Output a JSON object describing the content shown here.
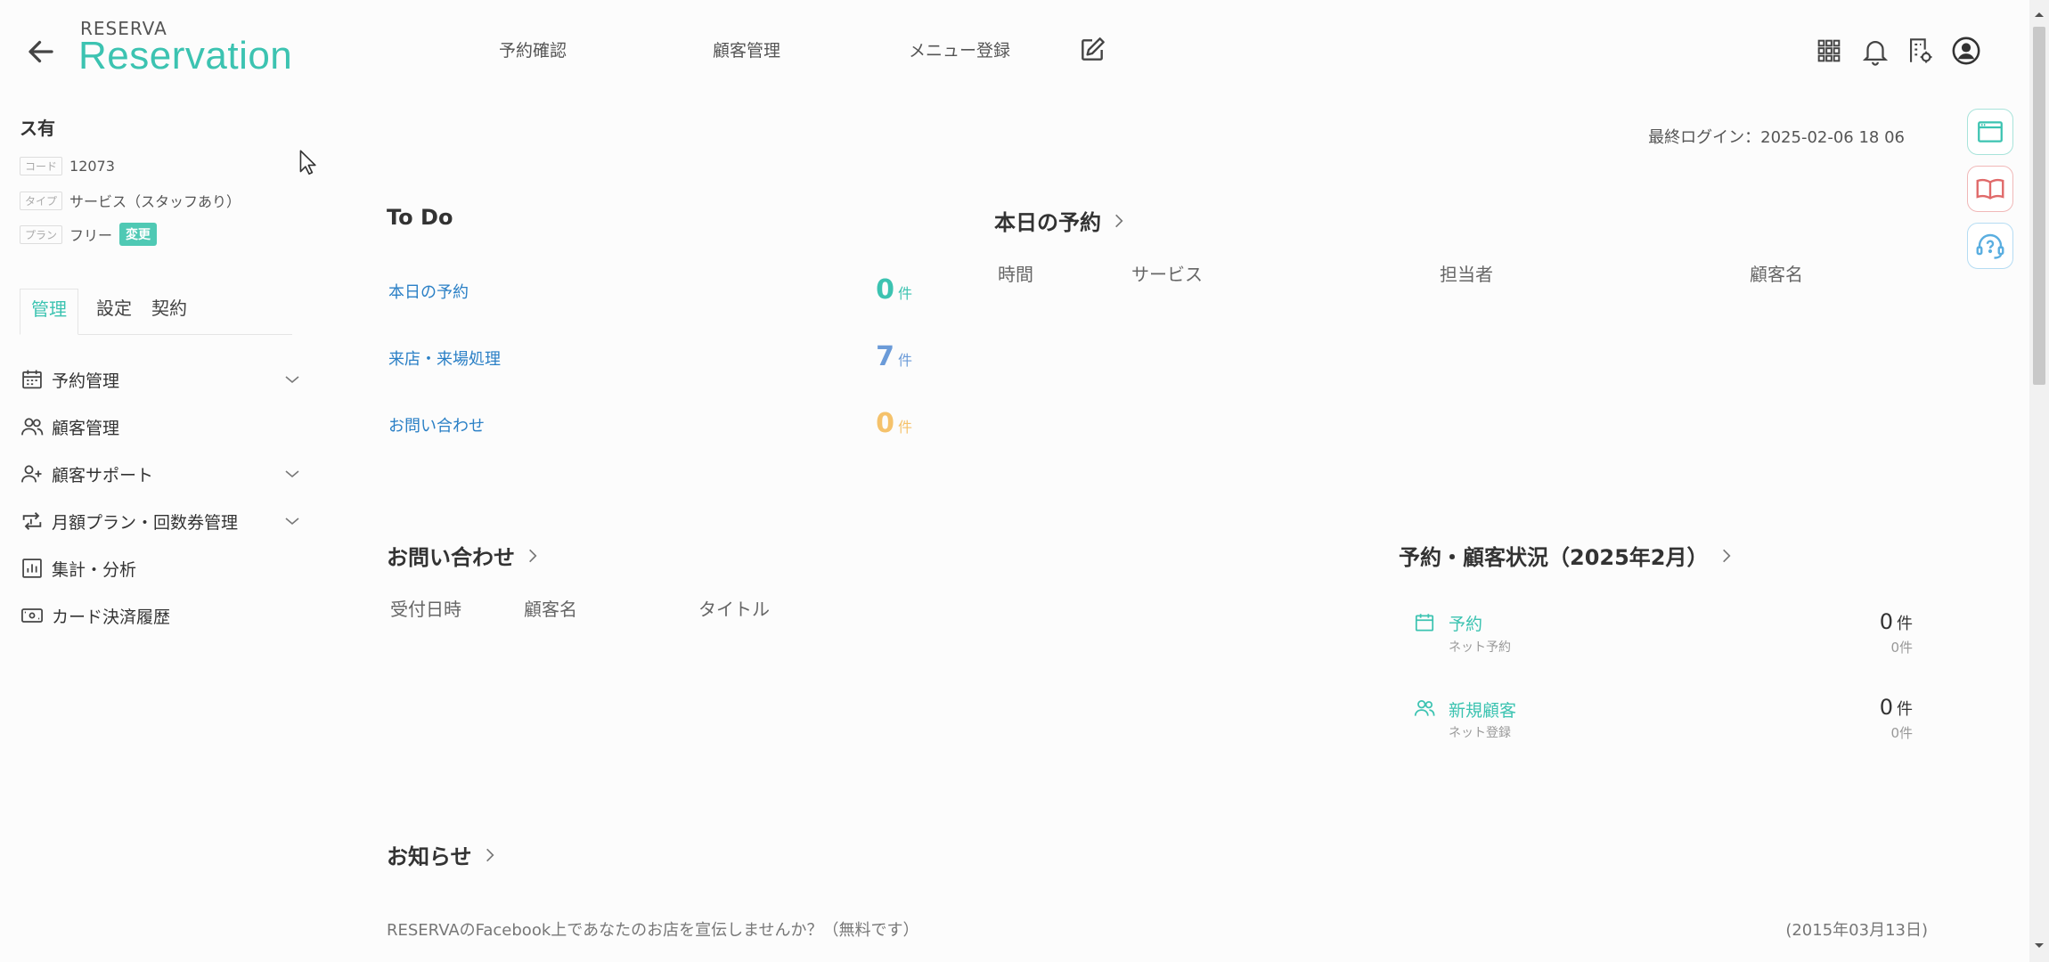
{
  "header": {
    "brand_small": "RESERVA",
    "brand_big": "Reservation",
    "nav": [
      {
        "label": "予約確認"
      },
      {
        "label": "顧客管理"
      },
      {
        "label": "メニュー登録"
      }
    ],
    "icons": [
      "apps-grid-icon",
      "bell-icon",
      "building-gear-icon",
      "user-avatar-icon"
    ]
  },
  "store": {
    "name": "ス有",
    "code_tag": "コード",
    "code": "12073",
    "type_tag": "タイプ",
    "type": "サービス（スタッフあり）",
    "plan_tag": "プラン",
    "plan": "フリー",
    "plan_change": "変更"
  },
  "sidebar": {
    "tabs": [
      {
        "label": "管理",
        "active": true
      },
      {
        "label": "設定",
        "active": false
      },
      {
        "label": "契約",
        "active": false
      }
    ],
    "items": [
      {
        "label": "予約管理",
        "icon": "calendar-icon",
        "expandable": true
      },
      {
        "label": "顧客管理",
        "icon": "users-icon",
        "expandable": false
      },
      {
        "label": "顧客サポート",
        "icon": "user-plus-icon",
        "expandable": true
      },
      {
        "label": "月額プラン・回数券管理",
        "icon": "repeat-icon",
        "expandable": true
      },
      {
        "label": "集計・分析",
        "icon": "bar-chart-icon",
        "expandable": false
      },
      {
        "label": "カード決済履歴",
        "icon": "card-icon",
        "expandable": false
      }
    ]
  },
  "main": {
    "last_login": "最終ログイン：2025-02-06 18 06",
    "todo": {
      "title": "To Do",
      "rows": [
        {
          "label": "本日の予約",
          "count": "0",
          "unit": "件",
          "color": "#3cc3b1"
        },
        {
          "label": "来店・来場処理",
          "count": "7",
          "unit": "件",
          "color": "#6b9bd8"
        },
        {
          "label": "お問い合わせ",
          "count": "0",
          "unit": "件",
          "color": "#f5c26b"
        }
      ]
    },
    "today": {
      "title": "本日の予約",
      "columns": [
        "時間",
        "サービス",
        "担当者",
        "顧客名"
      ]
    },
    "inquiries": {
      "title": "お問い合わせ",
      "columns": [
        "受付日時",
        "顧客名",
        "タイトル"
      ]
    },
    "status": {
      "title": "予約・顧客状況（2025年2月）",
      "rows": [
        {
          "label": "予約",
          "sub": "ネット予約",
          "count": "0",
          "unit": "件",
          "subcount": "0件",
          "icon": "calendar-icon"
        },
        {
          "label": "新規顧客",
          "sub": "ネット登録",
          "count": "0",
          "unit": "件",
          "subcount": "0件",
          "icon": "users-icon"
        }
      ]
    },
    "news": {
      "title": "お知らせ",
      "items": [
        {
          "text": "RESERVAのFacebook上であなたのお店を宣伝しませんか？（無料です）",
          "date": "(2015年03月13日)"
        }
      ]
    }
  },
  "float_buttons": [
    "browser-window-icon",
    "book-icon",
    "headset-help-icon"
  ],
  "colors": {
    "brand": "#3cc3b1",
    "link": "#2b80c6",
    "todo_blue": "#6b9bd8",
    "todo_orange": "#f5c26b",
    "book_red": "#e06a6a",
    "help_blue": "#5aaee0"
  }
}
